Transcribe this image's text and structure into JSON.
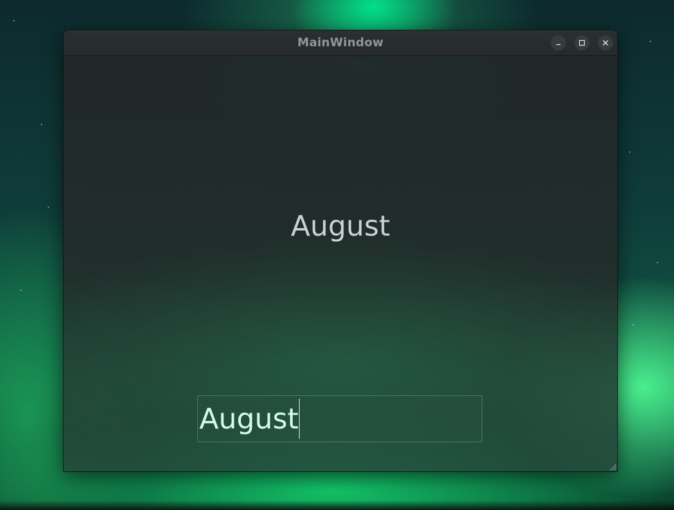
{
  "window": {
    "title": "MainWindow"
  },
  "titlebar_controls": {
    "minimize_icon": "minimize-icon",
    "maximize_icon": "maximize-icon",
    "close_icon": "close-icon"
  },
  "content": {
    "label_text": "August",
    "input_value": "August"
  },
  "colors": {
    "titlebar": "#252b2b",
    "title_text": "#8d9895",
    "label_text": "#c9d3d0",
    "input_text": "#d8fbe9"
  }
}
